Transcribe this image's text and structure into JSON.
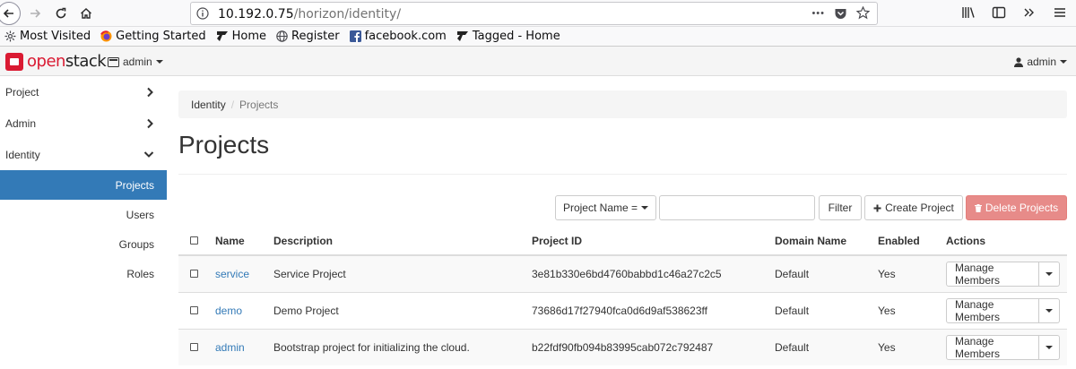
{
  "browser": {
    "url_host": "10.192.0.75",
    "url_path": "/horizon/identity/",
    "menu_dots": "•••",
    "bookmarks": [
      {
        "label": "Most Visited",
        "icon": "gear-icon"
      },
      {
        "label": "Getting Started",
        "icon": "firefox-icon"
      },
      {
        "label": "Home",
        "icon": "tagged-icon"
      },
      {
        "label": "Register",
        "icon": "globe-icon"
      },
      {
        "label": "facebook.com",
        "icon": "facebook-icon"
      },
      {
        "label": "Tagged - Home",
        "icon": "tagged-icon"
      }
    ]
  },
  "header": {
    "logo_open": "open",
    "logo_stack": "stack",
    "project": "admin",
    "user": "admin"
  },
  "sidebar": {
    "groups": [
      {
        "label": "Project",
        "expanded": false
      },
      {
        "label": "Admin",
        "expanded": false
      },
      {
        "label": "Identity",
        "expanded": true
      }
    ],
    "items": [
      {
        "label": "Projects",
        "active": true
      },
      {
        "label": "Users",
        "active": false
      },
      {
        "label": "Groups",
        "active": false
      },
      {
        "label": "Roles",
        "active": false
      }
    ]
  },
  "breadcrumb": {
    "parent": "Identity",
    "sep": "/",
    "current": "Projects"
  },
  "page_title": "Projects",
  "filter": {
    "field_label": "Project Name =",
    "input_value": "",
    "filter_button": "Filter",
    "create_button": "Create Project",
    "delete_button": "Delete Projects"
  },
  "table": {
    "headers": [
      "Name",
      "Description",
      "Project ID",
      "Domain Name",
      "Enabled",
      "Actions"
    ],
    "rows": [
      {
        "name": "service",
        "description": "Service Project",
        "id": "3e81b330e6bd4760babbd1c46a27c2c5",
        "domain": "Default",
        "enabled": "Yes",
        "action": "Manage Members"
      },
      {
        "name": "demo",
        "description": "Demo Project",
        "id": "73686d17f27940fca0d6d9af538623ff",
        "domain": "Default",
        "enabled": "Yes",
        "action": "Manage Members"
      },
      {
        "name": "admin",
        "description": "Bootstrap project for initializing the cloud.",
        "id": "b22fdf90fb094b83995cab072c792487",
        "domain": "Default",
        "enabled": "Yes",
        "action": "Manage Members"
      }
    ]
  },
  "colors": {
    "accent": "#337ab7",
    "brand": "#da1a32",
    "danger": "#e78b89"
  }
}
